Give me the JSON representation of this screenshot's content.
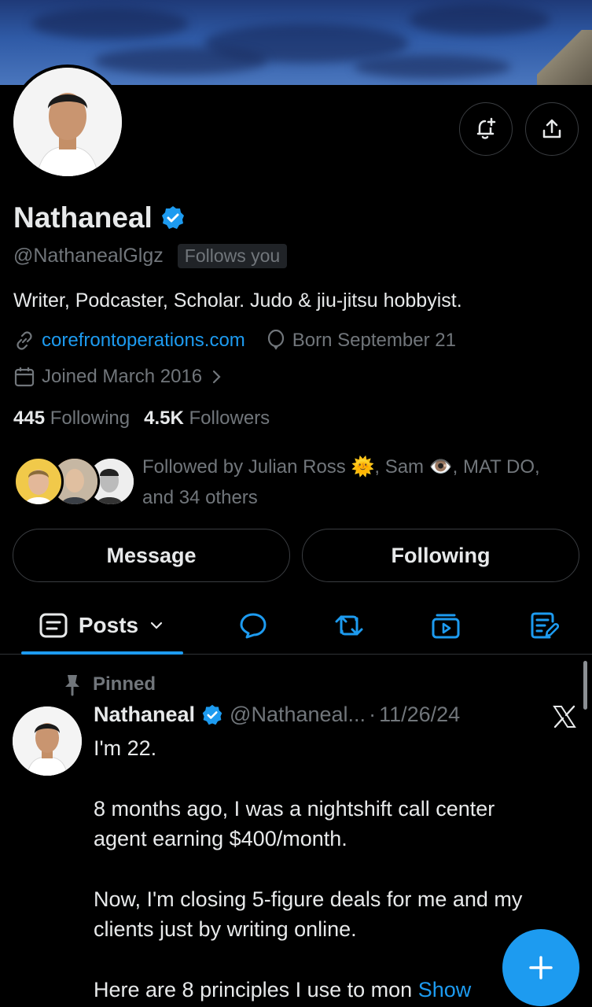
{
  "profile": {
    "name": "Nathaneal",
    "handle": "@NathanealGlgz",
    "follows_you": "Follows you",
    "bio": "Writer, Podcaster, Scholar. Judo & jiu-jitsu hobbyist.",
    "website": "corefrontoperations.com",
    "birthday": "Born September 21",
    "joined": "Joined March 2016",
    "following_count": "445",
    "following_label": "Following",
    "followers_count": "4.5K",
    "followers_label": "Followers",
    "followed_by_prefix": "Followed by Julian Ross",
    "followed_by_sam": ", Sam",
    "followed_by_mat": ", MAT DO,",
    "followed_by_others": "and 34 others"
  },
  "actions": {
    "message": "Message",
    "following": "Following"
  },
  "tabs": {
    "posts": "Posts"
  },
  "post": {
    "pinned_label": "Pinned",
    "author": "Nathaneal",
    "handle": "@Nathaneal...",
    "separator": "·",
    "date": "11/26/24",
    "line1": "I'm 22.",
    "line2": "8 months ago, I was a nightshift call center",
    "line3": "agent earning $400/month.",
    "line4": "Now, I'm closing 5-figure deals for me and my",
    "line5": "clients just by writing online.",
    "line6": "Here are 8 principles I use to mon",
    "show_more": "Show"
  },
  "colors": {
    "background": "#000000",
    "accent": "#1d9bf0",
    "text_primary": "#e7e9ea",
    "text_secondary": "#71767b",
    "border": "#3a3d41"
  },
  "icons": [
    "notification-bell-plus-icon",
    "share-upload-icon",
    "verified-badge-icon",
    "link-icon",
    "balloon-icon",
    "calendar-icon",
    "chevron-right-icon",
    "posts-icon",
    "chevron-down-icon",
    "replies-icon",
    "reposts-icon",
    "media-icon",
    "articles-icon",
    "pin-icon",
    "x-logo-icon",
    "compose-plus-icon"
  ]
}
